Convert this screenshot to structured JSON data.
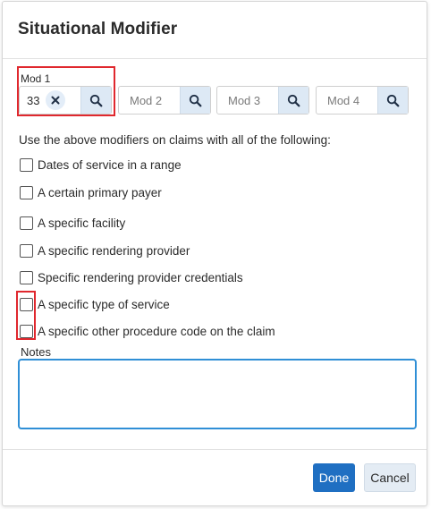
{
  "dialog": {
    "title": "Situational Modifier"
  },
  "modifiers": {
    "mod1": {
      "label": "Mod 1",
      "value": "33"
    },
    "mod2": {
      "placeholder": "Mod 2"
    },
    "mod3": {
      "placeholder": "Mod 3"
    },
    "mod4": {
      "placeholder": "Mod 4"
    }
  },
  "instruction": "Use the above modifiers on claims with all of the following:",
  "criteria": [
    {
      "label": "Dates of service in a range",
      "checked": false
    },
    {
      "label": "A certain primary payer",
      "checked": false
    },
    {
      "label": "A specific facility",
      "checked": false
    },
    {
      "label": "A specific rendering provider",
      "checked": false
    },
    {
      "label": "Specific rendering provider credentials",
      "checked": false
    },
    {
      "label": "A specific type of service",
      "checked": false
    },
    {
      "label": "A specific other procedure code on the claim",
      "checked": false
    }
  ],
  "notes": {
    "label": "Notes",
    "value": ""
  },
  "footer": {
    "done_label": "Done",
    "cancel_label": "Cancel"
  },
  "colors": {
    "primary": "#1f6fc2",
    "search_button_bg": "#dde9f5",
    "focus_border": "#2f8fd6",
    "annotation_red": "#e0282e"
  },
  "icons": {
    "search": "search-icon",
    "clear": "close-icon"
  }
}
